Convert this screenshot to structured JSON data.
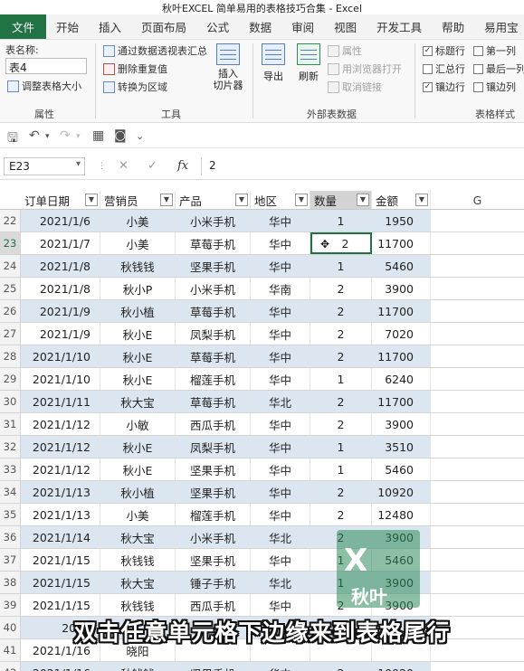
{
  "app": {
    "title": "秋叶EXCEL 简单易用的表格技巧合集  -  Excel"
  },
  "tabs": [
    "文件",
    "开始",
    "插入",
    "页面布局",
    "公式",
    "数据",
    "审阅",
    "视图",
    "开发工具",
    "帮助",
    "易用宝"
  ],
  "ribbon": {
    "table_name_label": "表名称:",
    "table_name_value": "表4",
    "resize_label": "调整表格大小",
    "properties_group": "属性",
    "summarize_pivot": "通过数据透视表汇总",
    "remove_duplicates": "删除重复值",
    "convert_range": "转换为区域",
    "insert_slicer": "插入\n切片器",
    "tools_group": "工具",
    "export_label": "导出",
    "refresh_label": "刷新",
    "properties_btn": "属性",
    "open_browser": "用浏览器打开",
    "unlink": "取消链接",
    "external_group": "外部表数据",
    "opt_header_row": "标题行",
    "opt_total_row": "汇总行",
    "opt_banded_rows": "镶边行",
    "opt_first_col": "第一列",
    "opt_last_col": "最后一列",
    "opt_banded_cols": "镶边列",
    "style_options_group": "表格样式选"
  },
  "formula_bar": {
    "name_box": "E23",
    "fx": "fx",
    "value": "2"
  },
  "table": {
    "headers": [
      "订单日期",
      "营销员",
      "产品",
      "地区",
      "数量",
      "金额"
    ],
    "extra_col": "G",
    "rows": [
      {
        "n": "22",
        "date": "2021/1/6",
        "rep": "小美",
        "prod": "小米手机",
        "region": "华中",
        "qty": "1",
        "amt": "1950"
      },
      {
        "n": "23",
        "date": "2021/1/7",
        "rep": "小美",
        "prod": "草莓手机",
        "region": "华中",
        "qty": "2",
        "amt": "11700"
      },
      {
        "n": "24",
        "date": "2021/1/8",
        "rep": "秋钱钱",
        "prod": "坚果手机",
        "region": "华中",
        "qty": "1",
        "amt": "5460"
      },
      {
        "n": "25",
        "date": "2021/1/8",
        "rep": "秋小P",
        "prod": "小米手机",
        "region": "华南",
        "qty": "2",
        "amt": "3900"
      },
      {
        "n": "26",
        "date": "2021/1/9",
        "rep": "秋小植",
        "prod": "草莓手机",
        "region": "华中",
        "qty": "2",
        "amt": "11700"
      },
      {
        "n": "27",
        "date": "2021/1/9",
        "rep": "秋小E",
        "prod": "凤梨手机",
        "region": "华中",
        "qty": "2",
        "amt": "7020"
      },
      {
        "n": "28",
        "date": "2021/1/10",
        "rep": "秋小E",
        "prod": "草莓手机",
        "region": "华中",
        "qty": "2",
        "amt": "11700"
      },
      {
        "n": "29",
        "date": "2021/1/10",
        "rep": "秋小E",
        "prod": "榴莲手机",
        "region": "华中",
        "qty": "1",
        "amt": "6240"
      },
      {
        "n": "30",
        "date": "2021/1/11",
        "rep": "秋大宝",
        "prod": "草莓手机",
        "region": "华北",
        "qty": "2",
        "amt": "11700"
      },
      {
        "n": "31",
        "date": "2021/1/12",
        "rep": "小敏",
        "prod": "西瓜手机",
        "region": "华中",
        "qty": "2",
        "amt": "3900"
      },
      {
        "n": "32",
        "date": "2021/1/12",
        "rep": "秋小E",
        "prod": "凤梨手机",
        "region": "华中",
        "qty": "1",
        "amt": "3510"
      },
      {
        "n": "33",
        "date": "2021/1/12",
        "rep": "秋小E",
        "prod": "坚果手机",
        "region": "华中",
        "qty": "1",
        "amt": "5460"
      },
      {
        "n": "34",
        "date": "2021/1/13",
        "rep": "秋小植",
        "prod": "坚果手机",
        "region": "华中",
        "qty": "2",
        "amt": "10920"
      },
      {
        "n": "35",
        "date": "2021/1/13",
        "rep": "小美",
        "prod": "榴莲手机",
        "region": "华中",
        "qty": "2",
        "amt": "12480"
      },
      {
        "n": "36",
        "date": "2021/1/14",
        "rep": "秋大宝",
        "prod": "小米手机",
        "region": "华北",
        "qty": "2",
        "amt": "3900"
      },
      {
        "n": "37",
        "date": "2021/1/15",
        "rep": "秋钱钱",
        "prod": "坚果手机",
        "region": "华中",
        "qty": "1",
        "amt": "5460"
      },
      {
        "n": "38",
        "date": "2021/1/15",
        "rep": "秋大宝",
        "prod": "锤子手机",
        "region": "华北",
        "qty": "1",
        "amt": "3900"
      },
      {
        "n": "39",
        "date": "2021/1/15",
        "rep": "秋钱钱",
        "prod": "西瓜手机",
        "region": "华中",
        "qty": "2",
        "amt": "3900"
      },
      {
        "n": "40",
        "date": "2021",
        "rep": "",
        "prod": "",
        "region": "",
        "qty": "",
        "amt": ""
      },
      {
        "n": "41",
        "date": "2021/1/16",
        "rep": "晓阳",
        "prod": "",
        "region": "",
        "qty": "",
        "amt": ""
      },
      {
        "n": "42",
        "date": "2021/1/16",
        "rep": "秋钱钱",
        "prod": "坚果手机",
        "region": "华中",
        "qty": "2",
        "amt": "10920"
      }
    ]
  },
  "overlay": {
    "logo_x": "X",
    "logo_text": "秋叶",
    "subtitle": "双击任意单元格下边缘来到表格尾行"
  },
  "colors": {
    "excel_green": "#217346",
    "band_blue": "#dce6f1"
  }
}
